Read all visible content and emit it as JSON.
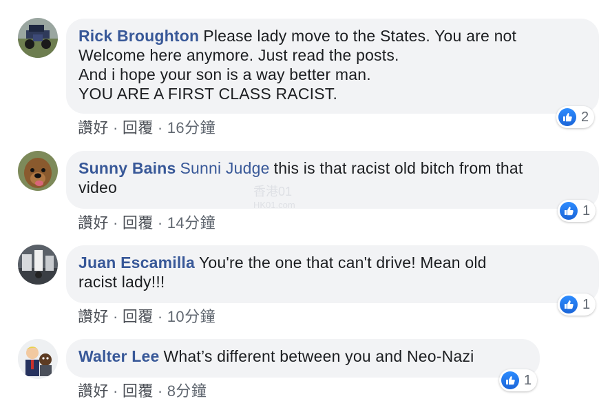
{
  "comments": [
    {
      "author": "Rick Broughton",
      "mention": "",
      "text": "Please lady move to the States. You are not\nWelcome here anymore. Just read the posts.\nAnd i hope your son is a way better man.\nYOU ARE A FIRST CLASS RACIST.",
      "like_label": "讚好",
      "reply_label": "回覆",
      "time": "16分鐘",
      "reaction_count": "2"
    },
    {
      "author": "Sunny Bains",
      "mention": "Sunni Judge",
      "text": "this is that racist old bitch from that\nvideo",
      "like_label": "讚好",
      "reply_label": "回覆",
      "time": "14分鐘",
      "reaction_count": "1"
    },
    {
      "author": "Juan Escamilla",
      "mention": "",
      "text": "You're the one that can't drive! Mean old\nracist lady!!!",
      "like_label": "讚好",
      "reply_label": "回覆",
      "time": "10分鐘",
      "reaction_count": "1"
    },
    {
      "author": "Walter Lee",
      "mention": "",
      "text": "What’s different between you and Neo-Nazi",
      "like_label": "讚好",
      "reply_label": "回覆",
      "time": "8分鐘",
      "reaction_count": "1"
    }
  ],
  "watermark": {
    "line1": "香港01",
    "line2": "HK01.com"
  },
  "colors": {
    "author": "#385898",
    "bubble": "#f2f3f5",
    "like": "#1b74e4"
  }
}
